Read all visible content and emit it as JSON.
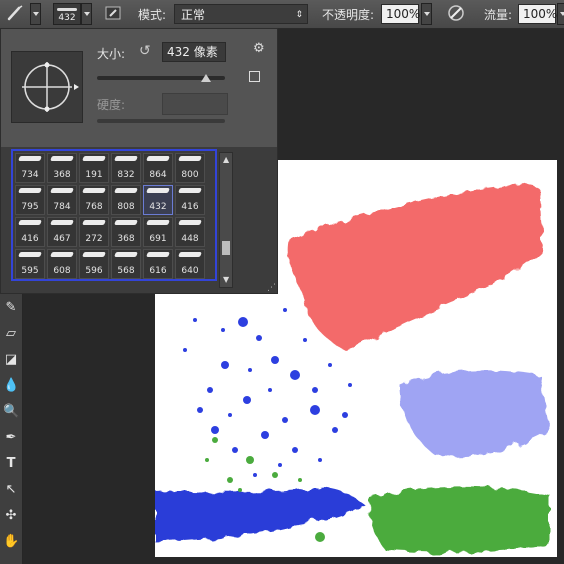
{
  "options_bar": {
    "brush_size_badge": "432",
    "mode_label": "模式:",
    "mode_value": "正常",
    "opacity_label": "不透明度:",
    "opacity_value": "100%",
    "flow_label": "流量:",
    "flow_value": "100%"
  },
  "brush_panel": {
    "size_label": "大小:",
    "size_value": "432 像素",
    "size_fraction": 0.85,
    "hardness_label": "硬度:",
    "presets": [
      {
        "n": "734"
      },
      {
        "n": "368"
      },
      {
        "n": "191"
      },
      {
        "n": "832"
      },
      {
        "n": "864"
      },
      {
        "n": "800"
      },
      {
        "n": "795"
      },
      {
        "n": "784"
      },
      {
        "n": "768"
      },
      {
        "n": "808"
      },
      {
        "n": "432"
      },
      {
        "n": "416"
      },
      {
        "n": "416"
      },
      {
        "n": "467"
      },
      {
        "n": "272"
      },
      {
        "n": "368"
      },
      {
        "n": "691"
      },
      {
        "n": "448"
      },
      {
        "n": "595"
      },
      {
        "n": "608"
      },
      {
        "n": "596"
      },
      {
        "n": "568"
      },
      {
        "n": "616"
      },
      {
        "n": "640"
      }
    ],
    "selected_preset_index": 10
  },
  "colors": {
    "red_stroke": "#f25a5a",
    "blue_splatter": "#2d3fe0",
    "purple_stroke": "#7f86f0",
    "blue_stroke": "#2a3ed8",
    "green_stroke": "#4bab3e",
    "selection_outline": "#3344d8"
  },
  "tools": [
    "brush-tool-icon",
    "eraser-tool-icon",
    "paint-bucket-icon",
    "blur-tool-icon",
    "dodge-tool-icon",
    "pen-tool-icon",
    "type-tool-icon",
    "path-select-icon",
    "custom-shape-icon",
    "hand-tool-icon"
  ]
}
